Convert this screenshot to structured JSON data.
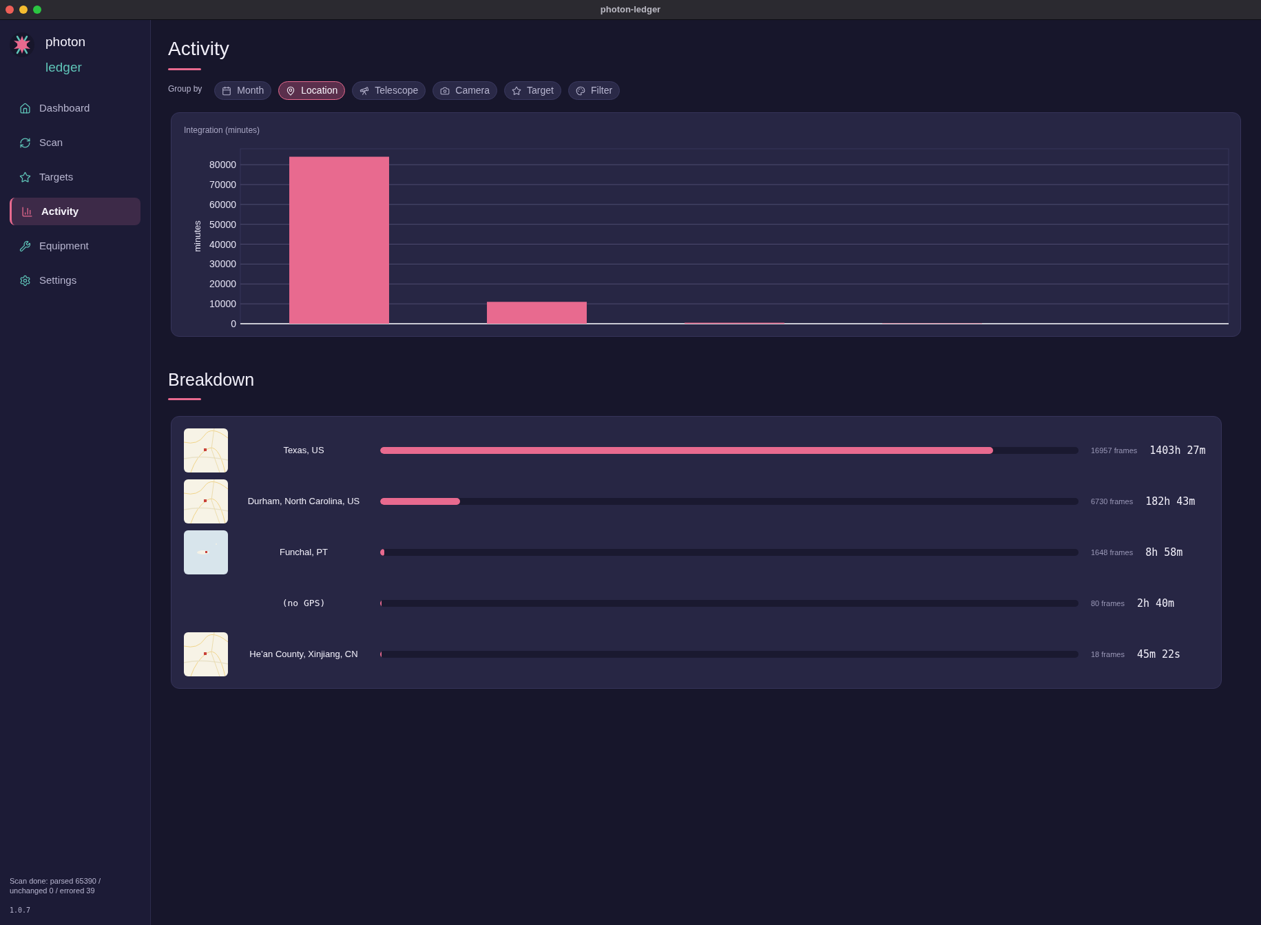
{
  "window": {
    "title": "photon-ledger"
  },
  "app": {
    "name": "photon",
    "subtitle": "ledger",
    "status": "Scan done: parsed 65390 / unchanged 0 / errored 39",
    "version": "1.0.7"
  },
  "sidebar": {
    "items": [
      {
        "label": "Dashboard",
        "selected": false
      },
      {
        "label": "Scan",
        "selected": false
      },
      {
        "label": "Targets",
        "selected": false
      },
      {
        "label": "Activity",
        "selected": true
      },
      {
        "label": "Equipment",
        "selected": false
      },
      {
        "label": "Settings",
        "selected": false
      }
    ]
  },
  "page": {
    "title": "Activity",
    "group_by_label": "Group by",
    "group_by": [
      {
        "label": "Month",
        "selected": false
      },
      {
        "label": "Location",
        "selected": true
      },
      {
        "label": "Telescope",
        "selected": false
      },
      {
        "label": "Camera",
        "selected": false
      },
      {
        "label": "Target",
        "selected": false
      },
      {
        "label": "Filter",
        "selected": false
      }
    ]
  },
  "chart": {
    "chart_data": {
      "type": "bar",
      "title": "Integration (minutes)",
      "ylabel": "minutes",
      "series": [
        {
          "color": "#e86a8f",
          "values": [
            84000,
            11000,
            500,
            200,
            null
          ]
        }
      ],
      "ylim": [
        0,
        88000
      ],
      "grid": true,
      "yticks": [
        0,
        10000,
        20000,
        30000,
        40000,
        50000,
        60000,
        70000,
        80000
      ]
    }
  },
  "breakdown": {
    "title": "Breakdown",
    "rows": [
      {
        "kind": "land",
        "label": "Texas, US",
        "level": 0.878,
        "frames": "16957 frames",
        "time": "1403h 27m"
      },
      {
        "kind": "land",
        "label": "Durham, North Carolina, US",
        "level": 0.114,
        "frames": "6730 frames",
        "time": "182h 43m"
      },
      {
        "kind": "sea",
        "label": "Funchal, PT",
        "level": 0.006,
        "frames": "1648 frames",
        "time": "8h 58m"
      },
      {
        "kind": "unknown",
        "label": "(no GPS)",
        "level": 0.002,
        "frames": "80 frames",
        "time": "2h 40m"
      },
      {
        "kind": "land",
        "label": "He’an County, Xinjiang, CN",
        "level": 0.001,
        "frames": "18 frames",
        "time": "45m 22s"
      }
    ]
  }
}
